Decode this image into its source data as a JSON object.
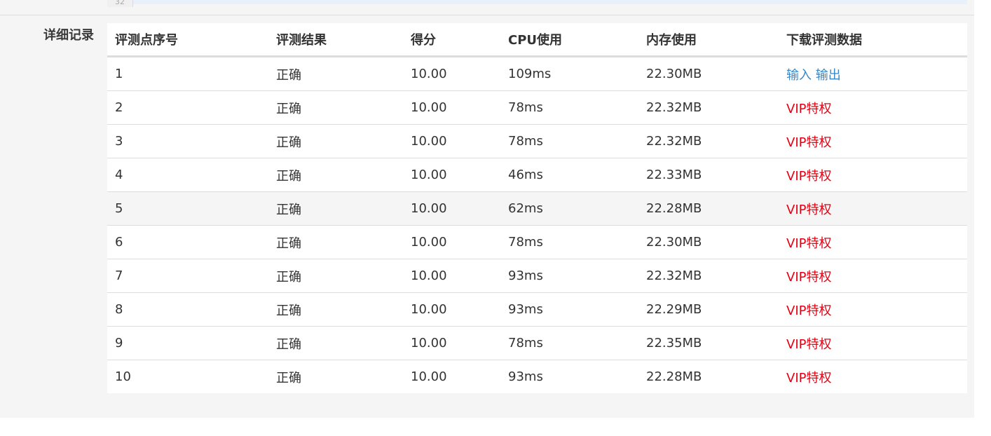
{
  "top": {
    "gutter_text": "32"
  },
  "section": {
    "label": "详细记录"
  },
  "table": {
    "headers": [
      "评测点序号",
      "评测结果",
      "得分",
      "CPU使用",
      "内存使用",
      "下载评测数据"
    ],
    "rows": [
      {
        "index": "1",
        "result": "正确",
        "score": "10.00",
        "cpu": "109ms",
        "memory": "22.30MB",
        "input_link": "输入",
        "output_link": "输出"
      },
      {
        "index": "2",
        "result": "正确",
        "score": "10.00",
        "cpu": "78ms",
        "memory": "22.32MB",
        "download": "VIP特权"
      },
      {
        "index": "3",
        "result": "正确",
        "score": "10.00",
        "cpu": "78ms",
        "memory": "22.32MB",
        "download": "VIP特权"
      },
      {
        "index": "4",
        "result": "正确",
        "score": "10.00",
        "cpu": "46ms",
        "memory": "22.33MB",
        "download": "VIP特权"
      },
      {
        "index": "5",
        "result": "正确",
        "score": "10.00",
        "cpu": "62ms",
        "memory": "22.28MB",
        "download": "VIP特权"
      },
      {
        "index": "6",
        "result": "正确",
        "score": "10.00",
        "cpu": "78ms",
        "memory": "22.30MB",
        "download": "VIP特权"
      },
      {
        "index": "7",
        "result": "正确",
        "score": "10.00",
        "cpu": "93ms",
        "memory": "22.32MB",
        "download": "VIP特权"
      },
      {
        "index": "8",
        "result": "正确",
        "score": "10.00",
        "cpu": "93ms",
        "memory": "22.29MB",
        "download": "VIP特权"
      },
      {
        "index": "9",
        "result": "正确",
        "score": "10.00",
        "cpu": "78ms",
        "memory": "22.35MB",
        "download": "VIP特权"
      },
      {
        "index": "10",
        "result": "正确",
        "score": "10.00",
        "cpu": "93ms",
        "memory": "22.28MB",
        "download": "VIP特权"
      }
    ]
  },
  "colors": {
    "link": "#3a87c8",
    "vip": "#e60012",
    "panel_bg": "#f5f5f5"
  }
}
